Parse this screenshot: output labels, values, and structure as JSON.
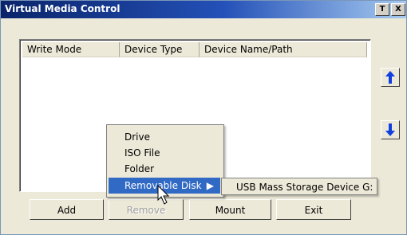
{
  "window": {
    "title": "Virtual Media Control",
    "pin_label": "T",
    "close_label": "X"
  },
  "table": {
    "columns": [
      "Write Mode",
      "Device Type",
      "Device Name/Path"
    ],
    "rows": []
  },
  "buttons": {
    "add": "Add",
    "remove": "Remove",
    "mount": "Mount",
    "exit": "Exit",
    "remove_enabled": false
  },
  "context_menu": {
    "items": [
      "Drive",
      "ISO File",
      "Folder",
      "Removable Disk"
    ],
    "selected": "Removable Disk",
    "submenu_arrow": "▶",
    "submenu_items": [
      "USB Mass Storage Device G:"
    ]
  },
  "icons": {
    "move_up": "arrow-up-icon",
    "move_down": "arrow-down-icon"
  },
  "colors": {
    "title_bar": "#0a246a",
    "selection": "#316ac5",
    "arrow": "#1040e0",
    "face": "#ece9d8"
  }
}
